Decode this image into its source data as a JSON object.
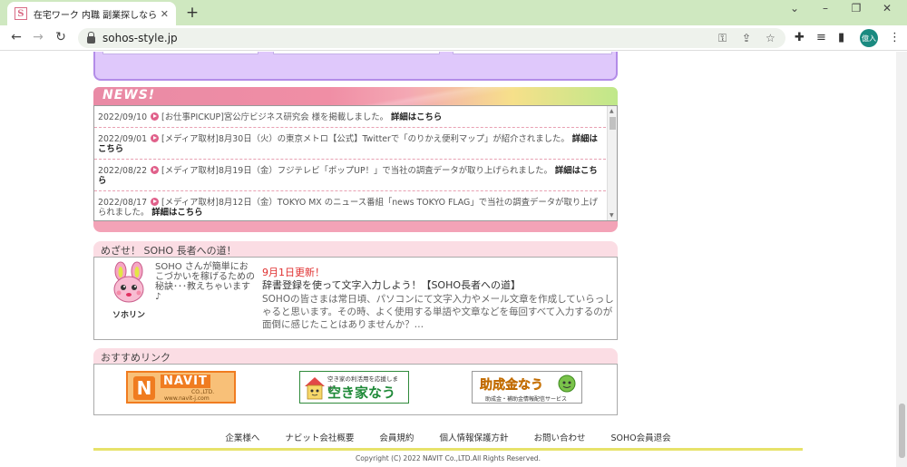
{
  "browser": {
    "tab_title": "在宅ワーク 内職 副業探しなら Soho",
    "tab_close": "✕",
    "new_tab": "+",
    "url": "sohos-style.jp",
    "profile_label": "億入",
    "favicon_letter": "S",
    "icons": [
      "back-arrow",
      "forward-arrow",
      "reload",
      "lock",
      "key",
      "share",
      "star",
      "extensions",
      "reading-list",
      "side-panel",
      "kebab-menu"
    ]
  },
  "news": {
    "title": "NEWS!",
    "items": [
      {
        "date": "2022/09/10",
        "text": "[お仕事PICKUP]宮公庁ビジネス研究会 様を掲載しました。",
        "link": "詳細はこちら"
      },
      {
        "date": "2022/09/01",
        "text": "[メディア取材]8月30日（火）の東京メトロ【公式】Twitterで「のりかえ便利マップ」が紹介されました。",
        "link": "詳細はこちら"
      },
      {
        "date": "2022/08/22",
        "text": "[メディア取材]8月19日（金）フジテレビ「ポップUP！」で当社の調査データが取り上げられました。",
        "link": "詳細はこちら"
      },
      {
        "date": "2022/08/17",
        "text": "[メディア取材]8月12日（金）TOKYO MX のニュース番組「news TOKYO FLAG」で当社の調査データが取り上げられました。",
        "link": "詳細はこちら"
      }
    ]
  },
  "soho_road": {
    "title": "めざせ！ SOHO 長者への道！",
    "mascot_name": "ソホリン",
    "intro": "SOHO さんが簡単におこづかいを稼げるための秘訣･･･教えちゃいます♪",
    "update_date": "9月1日更新！",
    "update_title": "辞書登録を使って文字入力しよう！【SOHO長者への道】",
    "update_body": "SOHOの皆さまは常日頃、パソコンにて文字入力やメール文章を作成していらっしゃると思います。その時、よく使用する単語や文章などを毎回すべて入力するのが面倒に感じたことはありませんか？…"
  },
  "recommended": {
    "title": "おすすめリンク",
    "banners": [
      {
        "name": "NAVIT",
        "sub": "CO.,LTD.",
        "url_text": "www.navit-j.com"
      },
      {
        "name": "空き家なう",
        "tagline": "空き家の利活用を応援します！"
      },
      {
        "name": "助成金なう",
        "tagline": "助成金・補助金情報配信サービス"
      }
    ]
  },
  "footer": {
    "links": [
      "企業様へ",
      "ナビット会社概要",
      "会員規約",
      "個人情報保護方針",
      "お問い合わせ",
      "SOHO会員退会"
    ],
    "copyright": "Copyright (C) 2022 NAVIT Co.,LTD.All Rights Reserved."
  }
}
